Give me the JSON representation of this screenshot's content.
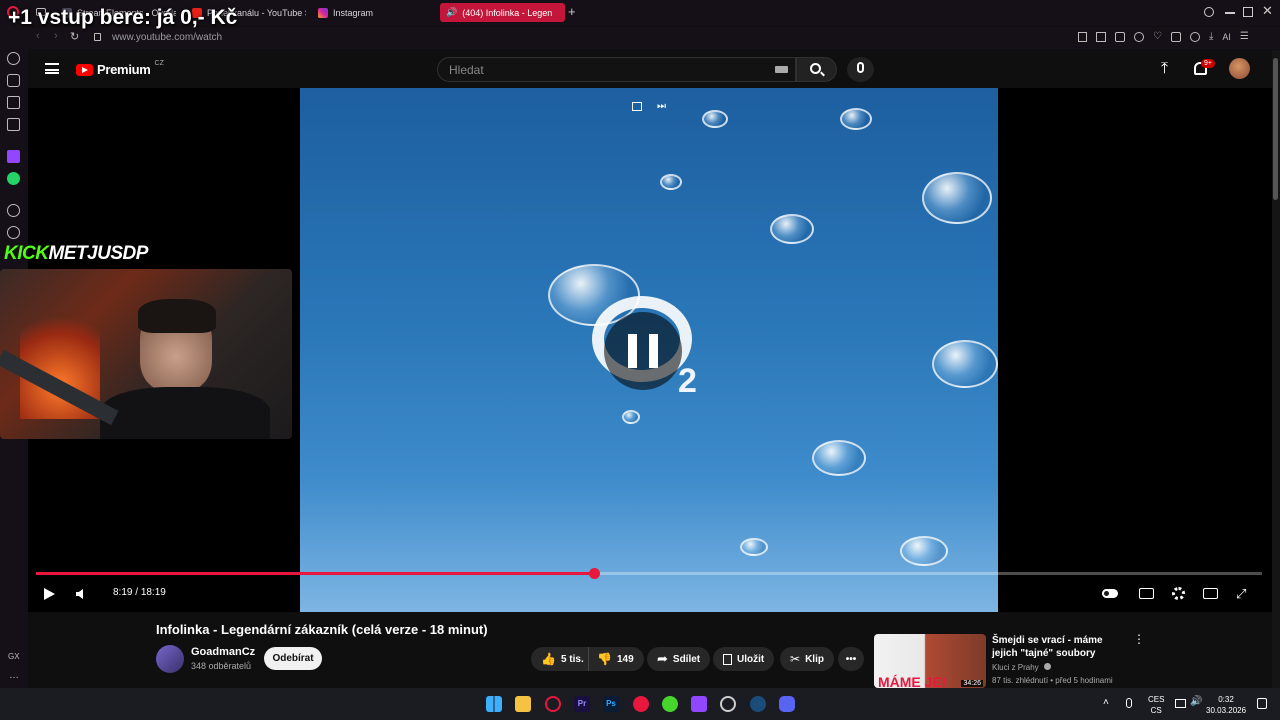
{
  "overlay": {
    "title": "+1 vstup bere: já 0,- Kč",
    "kick_brand": "KICK",
    "kick_user": "METJUSDP"
  },
  "browser": {
    "tabs": [
      {
        "label": "StreamElements - Overla",
        "icon": "streamelements-icon"
      },
      {
        "label": "Panel kanálu - YouTube St",
        "icon": "youtube-studio-icon"
      },
      {
        "label": "Instagram",
        "icon": "instagram-icon"
      },
      {
        "label": "(404) Infolinka - Legen",
        "icon": "speaker-icon",
        "active": true
      }
    ],
    "url": "www.youtube.com/watch",
    "sidebar_label": "GX",
    "accent": "#c4163a"
  },
  "youtube": {
    "logo_text": "Premium",
    "logo_region": "CZ",
    "search_placeholder": "Hledat",
    "notif_badge": "9+",
    "brand_red": "#ff0000"
  },
  "player": {
    "time_current": "8:19",
    "time_separator": "/",
    "time_total": "18:19",
    "progress_fraction": 0.455,
    "subscript": "2",
    "progress_color": "#e8173d"
  },
  "video": {
    "title": "Infolinka - Legendární zákazník (celá verze - 18 minut)",
    "channel": "GoadmanCz",
    "subscribers": "348 odběratelů",
    "subscribe_label": "Odebírat",
    "likes": "5 tis.",
    "dislikes": "149",
    "share_label": "Sdílet",
    "save_label": "Uložit",
    "clip_label": "Klip"
  },
  "recommendation": {
    "title": "Šmejdi se vrací - máme jejich \"tajné\" soubory",
    "channel": "Kluci z Prahy",
    "meta": "87 tis. zhlédnutí • před 5 hodinami",
    "thumb_text": "MÁME JE!",
    "duration": "34:26"
  },
  "taskbar": {
    "lang_top": "CES",
    "lang_bottom": "CS",
    "time": "0:32",
    "date": "30.03.2026"
  }
}
